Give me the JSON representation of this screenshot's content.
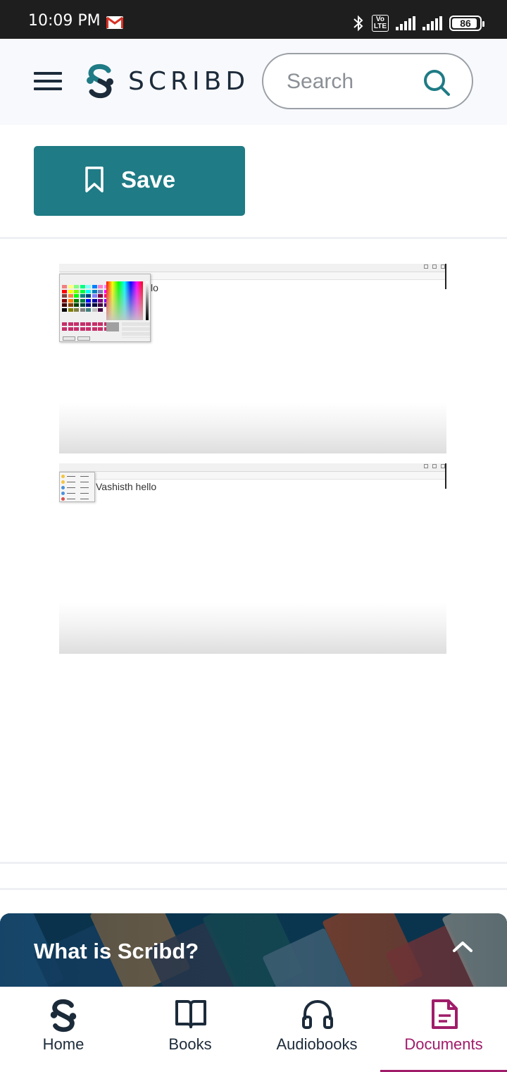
{
  "status_bar": {
    "time": "10:09 PM",
    "battery_level": "86",
    "icons": [
      "gmail-icon",
      "bluetooth-icon",
      "volte-icon",
      "4g-signal-icon",
      "signal-icon",
      "battery-icon"
    ]
  },
  "header": {
    "brand": "SCRIBD",
    "search": {
      "placeholder": "Search"
    }
  },
  "actions": {
    "save_label": "Save"
  },
  "document": {
    "pages": [
      {
        "visible_text": "lo"
      },
      {
        "visible_text": "Vashisth hello"
      }
    ]
  },
  "promo": {
    "title": "What is Scribd?"
  },
  "bottom_nav": {
    "items": [
      {
        "label": "Home",
        "icon": "scribd-logo-icon",
        "active": false
      },
      {
        "label": "Books",
        "icon": "book-icon",
        "active": false
      },
      {
        "label": "Audiobooks",
        "icon": "headphones-icon",
        "active": false
      },
      {
        "label": "Documents",
        "icon": "document-icon",
        "active": true
      }
    ]
  },
  "colors": {
    "brand_teal": "#1f7b85",
    "brand_navy": "#1c2b3a",
    "active_magenta": "#a01c6a",
    "promo_bg": "#0d3d58"
  }
}
